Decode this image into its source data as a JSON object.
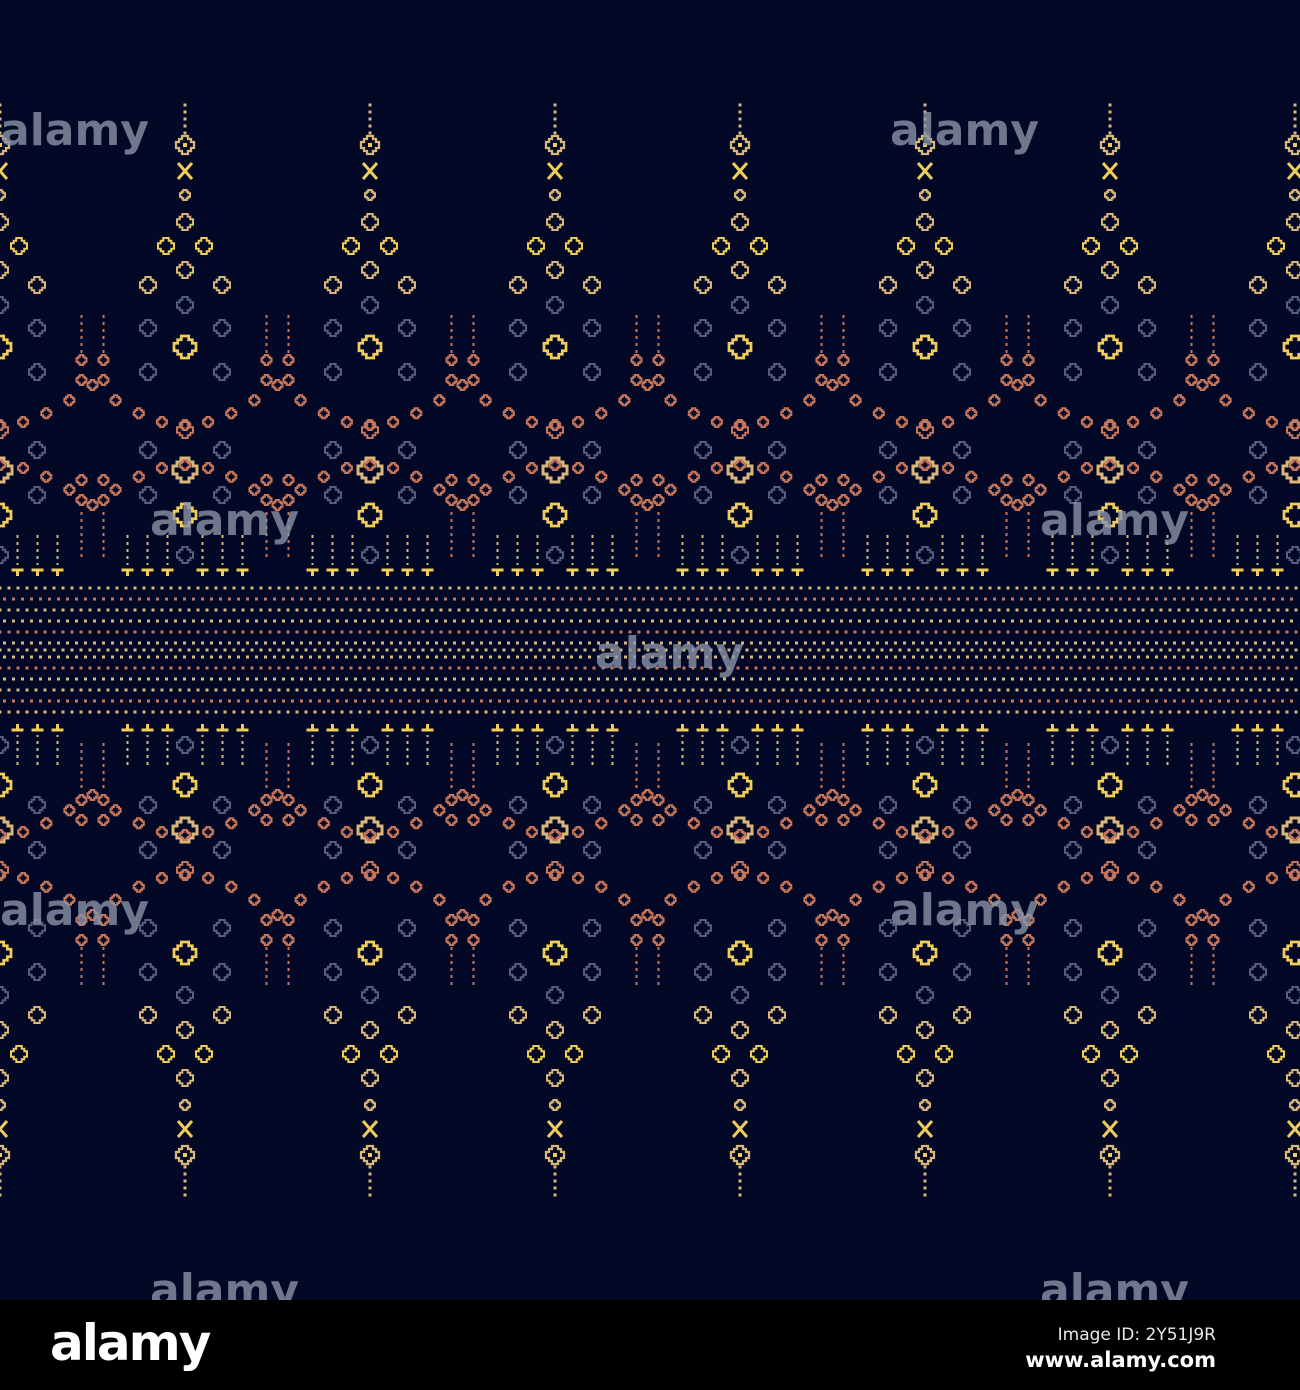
{
  "colors": {
    "background": "#020826",
    "yellow": "#f0cd5a",
    "beige": "#d9b77a",
    "orange": "#c6765a",
    "blue": "#56607e",
    "footer": "#000000"
  },
  "watermark": "alamy",
  "footer": {
    "logo": "alamy",
    "image_id": "Image ID: 2Y51J9R",
    "website": "www.alamy.com"
  }
}
